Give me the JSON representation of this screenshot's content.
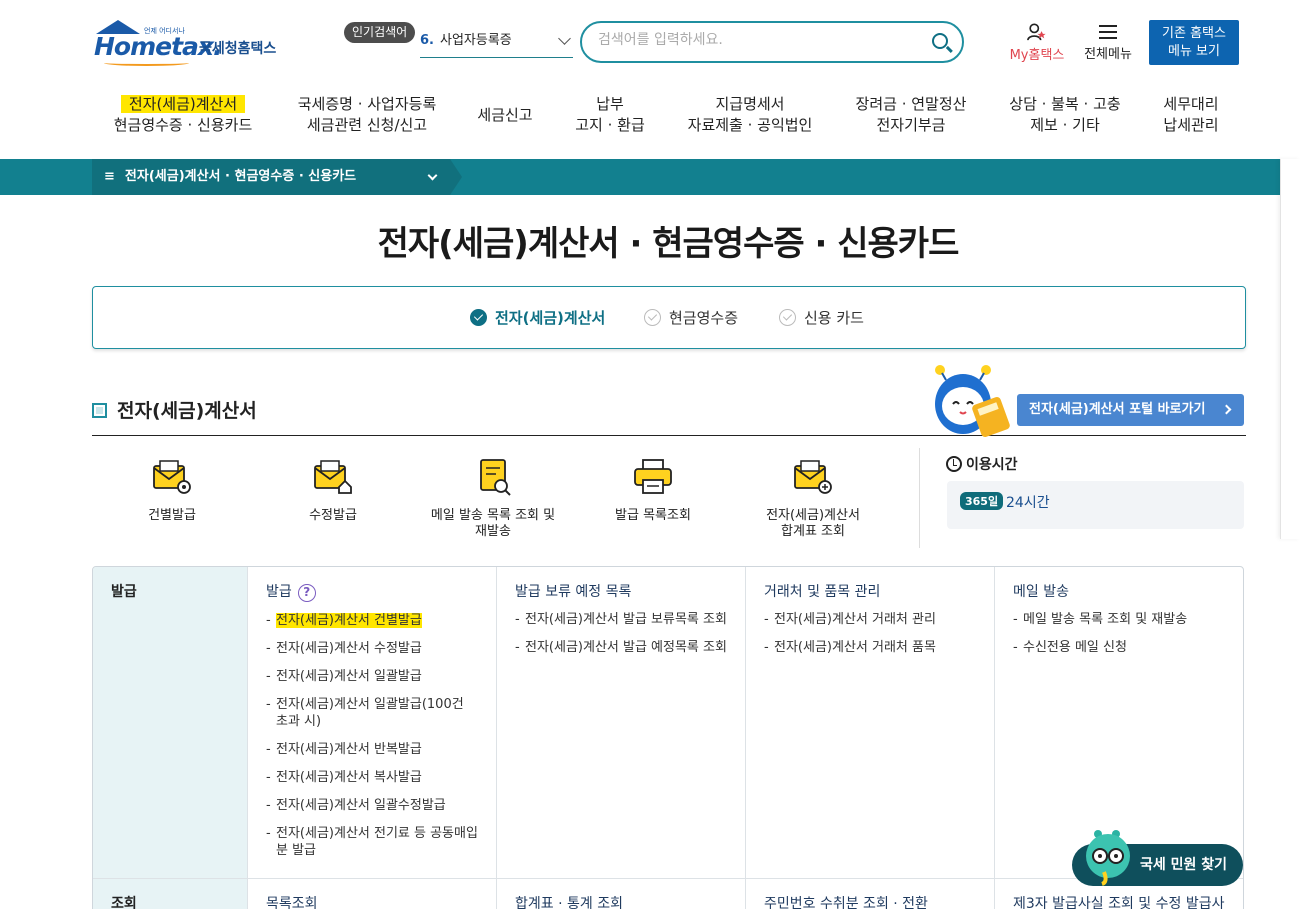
{
  "header": {
    "logo_text": "Hometax.",
    "logo_kr": "국세청홈택스",
    "logo_small": "언제 어디서나",
    "popular_badge": "인기검색어",
    "popular_rank": "6.",
    "popular_term": "사업자등록증",
    "search_placeholder": "검색어를 입력하세요.",
    "my_label": "My홈택스",
    "allmenu_label": "전체메뉴",
    "old_btn_line1": "기존 홈택스",
    "old_btn_line2": "메뉴 보기"
  },
  "gnb": [
    {
      "line1": "전자(세금)계산서",
      "line2": "현금영수증 · 신용카드"
    },
    {
      "line1": "국세증명 · 사업자등록",
      "line2": "세금관련 신청/신고"
    },
    {
      "line1": "세금신고",
      "line2": ""
    },
    {
      "line1": "납부",
      "line2": "고지 · 환급"
    },
    {
      "line1": "지급명세서",
      "line2": "자료제출 · 공익법인"
    },
    {
      "line1": "장려금 · 연말정산",
      "line2": "전자기부금"
    },
    {
      "line1": "상담 · 불복 · 고충",
      "line2": "제보 · 기타"
    },
    {
      "line1": "세무대리",
      "line2": "납세관리"
    }
  ],
  "breadcrumb": "전자(세금)계산서 · 현금영수증 · 신용카드",
  "page_title": "전자(세금)계산서 · 현금영수증 · 신용카드",
  "tabs": [
    "전자(세금)계산서",
    "현금영수증",
    "신용 카드"
  ],
  "section_title": "전자(세금)계산서",
  "portal_button": "전자(세금)계산서 포털 바로가기",
  "quick_menu": [
    {
      "label1": "건별발급",
      "label2": ""
    },
    {
      "label1": "수정발급",
      "label2": ""
    },
    {
      "label1": "메일 발송 목록 조회 및",
      "label2": "재발송"
    },
    {
      "label1": "발급 목록조회",
      "label2": ""
    },
    {
      "label1": "전자(세금)계산서",
      "label2": "합계표 조회"
    }
  ],
  "usage": {
    "title": "이용시간",
    "days": "365일",
    "hours": "24시간"
  },
  "grid": {
    "row1_head": "발급",
    "row2_head": "조회",
    "col1": {
      "title": "발급",
      "help": "?",
      "items": [
        "전자(세금)계산서 건별발급",
        "전자(세금)계산서 수정발급",
        "전자(세금)계산서 일괄발급",
        "전자(세금)계산서 일괄발급(100건 초과 시)",
        "전자(세금)계산서 반복발급",
        "전자(세금)계산서 복사발급",
        "전자(세금)계산서 일괄수정발급",
        "전자(세금)계산서 전기료 등 공동매입분 발급"
      ]
    },
    "col2": {
      "title": "발급 보류 예정 목록",
      "items": [
        "전자(세금)계산서 발급 보류목록 조회",
        "전자(세금)계산서 발급 예정목록 조회"
      ]
    },
    "col3": {
      "title": "거래처 및 품목 관리",
      "items": [
        "전자(세금)계산서 거래처 관리",
        "전자(세금)계산서 거래처 품목"
      ]
    },
    "col4": {
      "title": "메일 발송",
      "items": [
        "메일 발송 목록 조회 및 재발송",
        "수신전용 메일 신청"
      ]
    },
    "row2": [
      "목록조회",
      "합계표 · 통계 조회",
      "주민번호 수취분 조회 · 전환",
      "제3자 발급사실 조회 및 수정 발급사"
    ]
  },
  "float_button": "국세 민원 찾기",
  "colors": {
    "teal": "#12808f",
    "highlight": "#ffe600",
    "brand_blue": "#0d64b0"
  }
}
